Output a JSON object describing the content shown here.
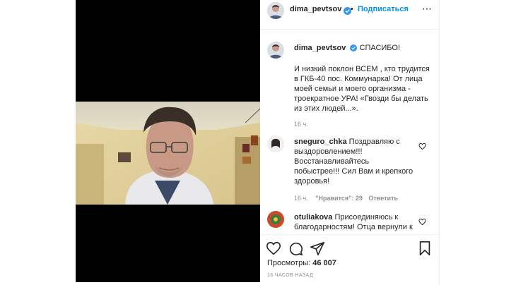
{
  "header": {
    "username": "dima_pevtsov",
    "separator": "•",
    "follow_label": "Подписаться",
    "more_glyph": "⋯"
  },
  "caption": {
    "username": "dima_pevtsov",
    "title": "СПАСИБО!",
    "body": "И низкий поклон ВСЕМ , кто трудится в ГКБ-40 пос. Коммунарка! От лица моей семьи и моего организма - троекратное УРА! «Гвозди бы делать из этих людей...».",
    "time": "16 ч."
  },
  "comments": [
    {
      "username": "sneguro_chka",
      "text": "Поздравляю с выздоровлением!!! Восстанавливайтесь побыстрее!!! Сил Вам и крепкого здоровья!",
      "time": "16 ч.",
      "likes": "\"Нравится\": 29",
      "reply": "Ответить"
    },
    {
      "username": "otuliakova",
      "text": "Присоединяюсь к благодарностям! Отца вернули к"
    }
  ],
  "stats": {
    "views_label": "Просмотры:",
    "views_value": "46 007",
    "time_ago": "16 ЧАСОВ НАЗАД"
  },
  "icons": {
    "header_avatar": "avatar",
    "verified": "verified-badge-icon",
    "like": "heart-icon",
    "comment": "comment-icon",
    "share": "paper-plane-icon",
    "save": "bookmark-icon"
  },
  "colors": {
    "link": "#0095f6",
    "verified": "#3897f0",
    "muted": "#8e8e8e",
    "text": "#262626"
  }
}
